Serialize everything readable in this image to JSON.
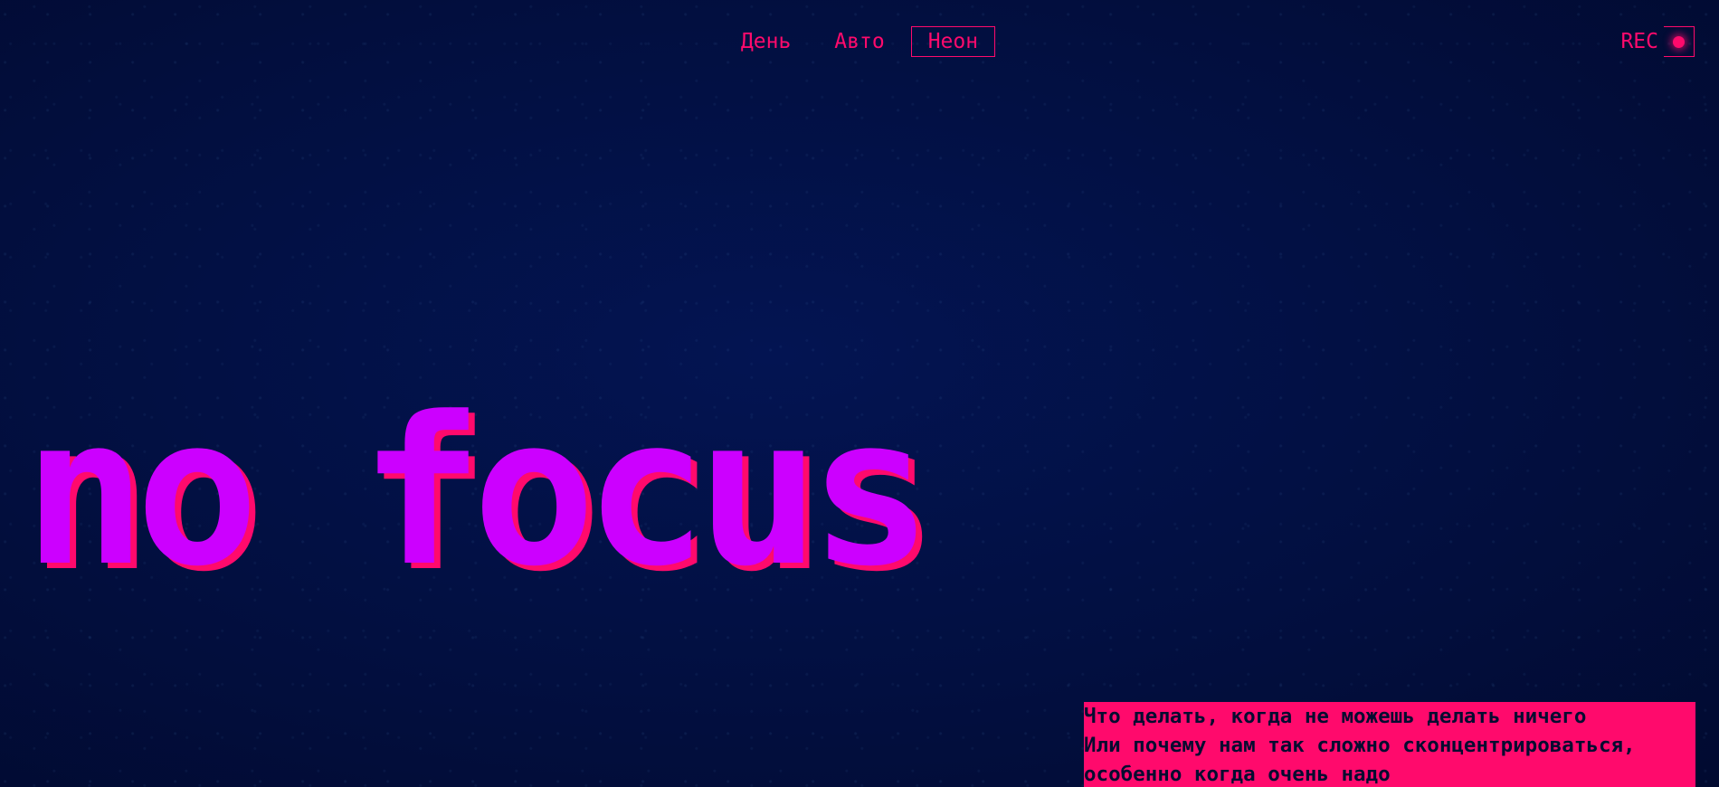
{
  "nav": {
    "items": [
      {
        "label": "День",
        "active": false
      },
      {
        "label": "Авто",
        "active": false
      },
      {
        "label": "Неон",
        "active": true
      }
    ]
  },
  "rec": {
    "label": "REC"
  },
  "hero": {
    "title": "no focus"
  },
  "subtitle": {
    "lines": [
      "Что делать, когда не можешь делать ничего",
      "Или почему нам так сложно сконцентрироваться,",
      "особенно когда очень надо"
    ]
  },
  "colors": {
    "background": "#020f40",
    "accent": "#ff0a6c",
    "hero": "#cc00ff",
    "subtitle_text": "#040c30"
  }
}
